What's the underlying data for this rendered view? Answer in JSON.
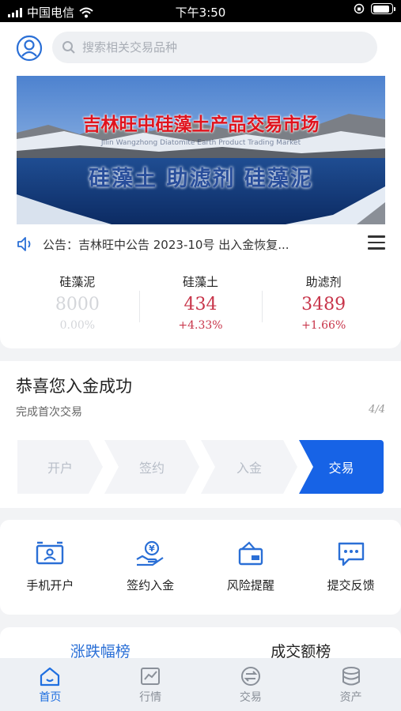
{
  "statusbar": {
    "carrier": "中国电信",
    "time": "下午3:50",
    "battery_level": 0.9
  },
  "search": {
    "placeholder": "搜索相关交易品种"
  },
  "banner": {
    "title": "吉林旺中硅藻土产品交易市场",
    "subtitle": "Jilin Wangzhong Diatomite Earth Product Trading Market",
    "slogan": "硅藻土  助滤剂  硅藻泥"
  },
  "notice": {
    "text": "公告：吉林旺中公告 2023-10号 出入金恢复..."
  },
  "quotes": [
    {
      "name": "硅藻泥",
      "price": "8000",
      "change": "0.00%",
      "trend": "flat"
    },
    {
      "name": "硅藻土",
      "price": "434",
      "change": "+4.33%",
      "trend": "up"
    },
    {
      "name": "助滤剂",
      "price": "3489",
      "change": "+1.66%",
      "trend": "up"
    }
  ],
  "guide": {
    "heading": "恭喜您入金成功",
    "sub": "完成首次交易",
    "step": "4/4",
    "steps": [
      "开户",
      "签约",
      "入金",
      "交易"
    ],
    "current_step": 4
  },
  "shortcuts": [
    {
      "label": "手机开户",
      "icon": "id-card-icon"
    },
    {
      "label": "签约入金",
      "icon": "yuan-hand-icon"
    },
    {
      "label": "风险提醒",
      "icon": "risk-card-icon"
    },
    {
      "label": "提交反馈",
      "icon": "chat-bubble-icon"
    }
  ],
  "rank_tabs": [
    "涨跌幅榜",
    "成交额榜"
  ],
  "tabbar": [
    {
      "label": "首页",
      "icon": "home-icon",
      "active": true
    },
    {
      "label": "行情",
      "icon": "chart-icon",
      "active": false
    },
    {
      "label": "交易",
      "icon": "exchange-icon",
      "active": false
    },
    {
      "label": "资产",
      "icon": "database-icon",
      "active": false
    }
  ],
  "colors": {
    "accent": "#1763e6",
    "up": "#c8354a",
    "flat": "#d4d6da",
    "tab_active": "#1f6fe0"
  }
}
